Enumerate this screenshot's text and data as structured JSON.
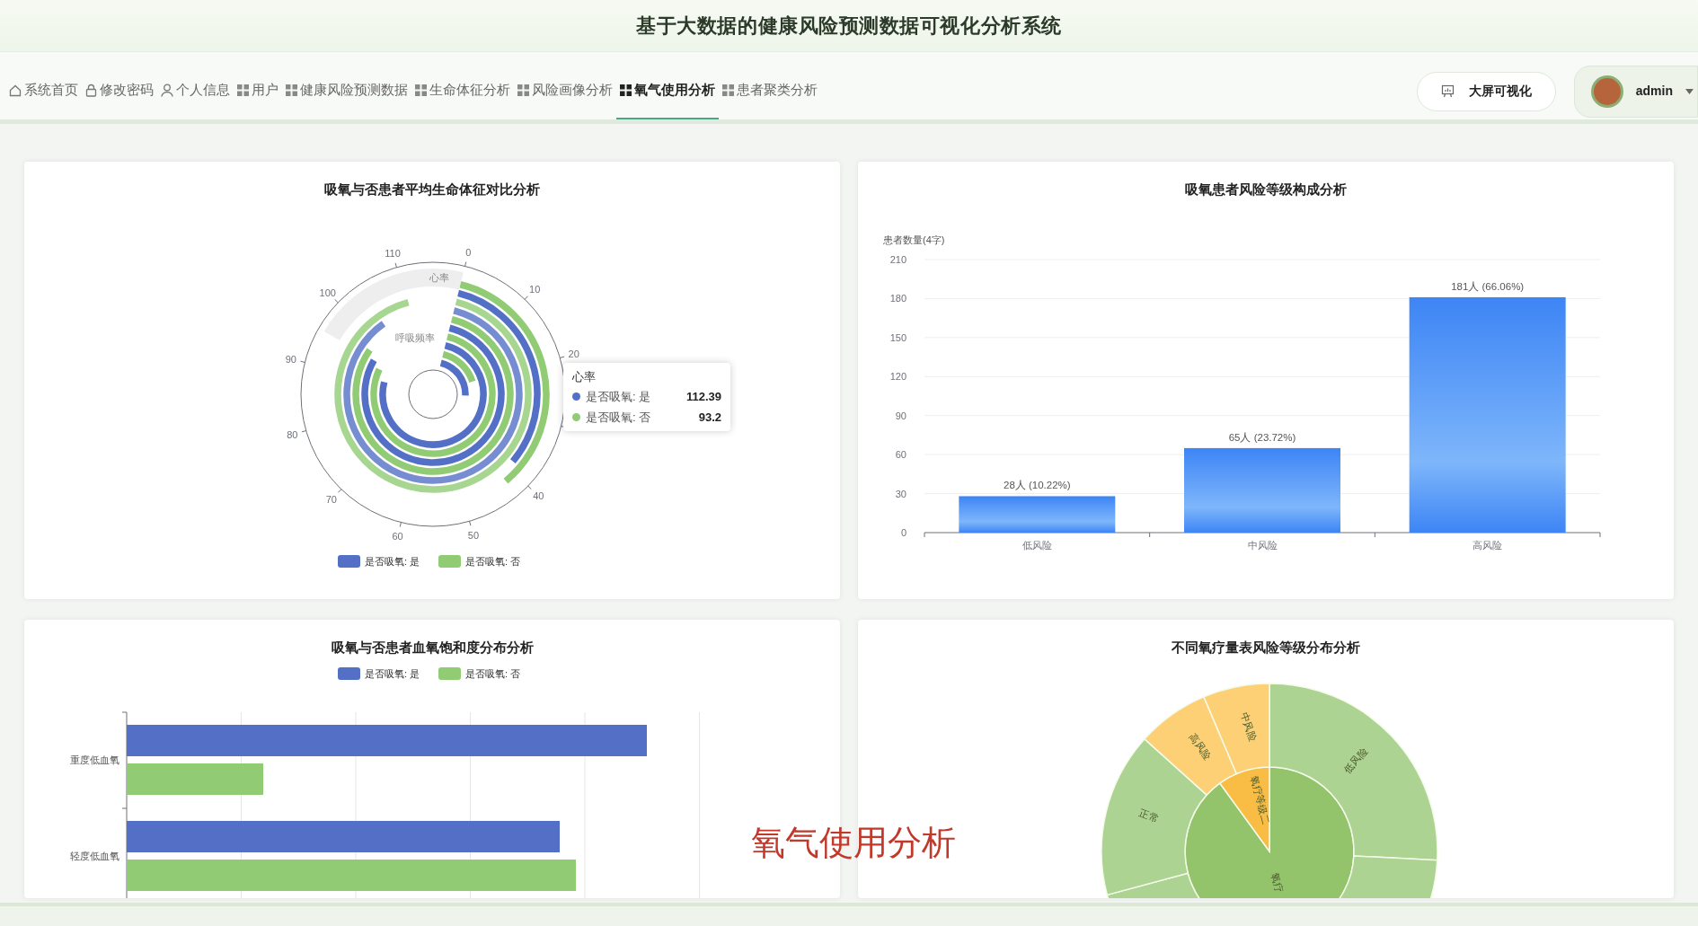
{
  "header": {
    "title": "基于大数据的健康风险预测数据可视化分析系统"
  },
  "nav": {
    "items": [
      {
        "label": "系统首页",
        "selected": false
      },
      {
        "label": "修改密码",
        "selected": false
      },
      {
        "label": "个人信息",
        "selected": false
      },
      {
        "label": "用户",
        "selected": false
      },
      {
        "label": "健康风险预测数据",
        "selected": false
      },
      {
        "label": "生命体征分析",
        "selected": false
      },
      {
        "label": "风险画像分析",
        "selected": false
      },
      {
        "label": "氧气使用分析",
        "selected": true
      },
      {
        "label": "患者聚类分析",
        "selected": false
      }
    ]
  },
  "screen_button": {
    "label": "大屏可视化"
  },
  "user": {
    "name": "admin"
  },
  "vitals_panel": {
    "title": "吸氧与否患者平均生命体征对比分析",
    "angle_ticks": [
      "0",
      "10",
      "20",
      "40",
      "50",
      "60",
      "70",
      "80",
      "90",
      "100",
      "110"
    ],
    "radius_labels": [
      "心率",
      "呼吸频率"
    ],
    "tooltip": {
      "title": "心率",
      "rows": [
        {
          "label": "是否吸氧: 是",
          "value": "112.39",
          "color": "#5470c6"
        },
        {
          "label": "是否吸氧: 否",
          "value": "93.2",
          "color": "#91cc75"
        }
      ]
    },
    "legend": [
      {
        "label": "是否吸氧: 是",
        "color": "#5470c6"
      },
      {
        "label": "是否吸氧: 否",
        "color": "#91cc75"
      }
    ]
  },
  "risk_panel": {
    "title": "吸氧患者风险等级构成分析",
    "chart_data": {
      "type": "bar",
      "ylabel": "患者数量(4字)",
      "categories": [
        "低风险",
        "中风险",
        "高风险"
      ],
      "series": [
        {
          "color": "#3d85f5",
          "values": [
            28,
            65,
            181
          ]
        }
      ],
      "grid": true,
      "ylim": [
        0,
        210
      ],
      "yticks": [
        0,
        30,
        60,
        90,
        120,
        150,
        180,
        210
      ],
      "value_labels": [
        "28人 (10.22%)",
        "65人 (23.72%)",
        "181人 (66.06%)"
      ]
    }
  },
  "spo2_panel": {
    "title": "吸氧与否患者血氧饱和度分布分析",
    "legend": [
      {
        "label": "是否吸氧: 是",
        "color": "#5470c6"
      },
      {
        "label": "是否吸氧: 否",
        "color": "#91cc75"
      }
    ],
    "categories": [
      "重度低血氧",
      "轻度低血氧"
    ]
  },
  "therapy_panel": {
    "title": "不同氧疗量表风险等级分布分析",
    "inner_labels": [
      "氧疗等级二",
      "氧疗"
    ],
    "outer_labels": [
      "低风险",
      "中风险",
      "高风险",
      "正常"
    ]
  },
  "caption": "氧气使用分析"
}
